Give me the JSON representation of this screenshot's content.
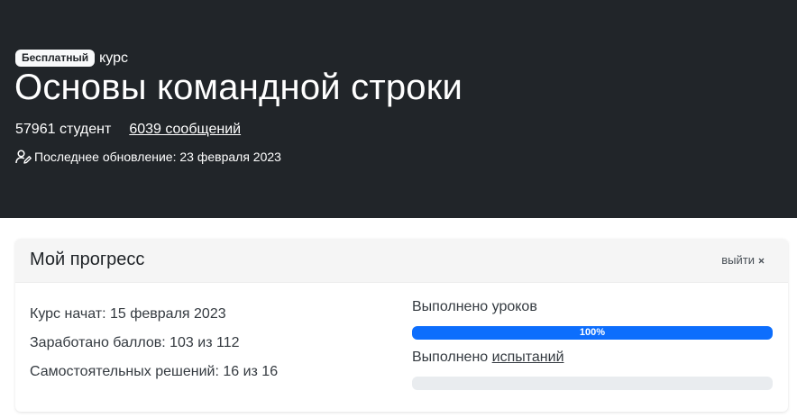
{
  "hero": {
    "badge": "Бесплатный",
    "course_word": "курс",
    "title": "Основы командной строки",
    "students": "57961 студент",
    "messages": "6039 сообщений",
    "last_update": "Последнее обновление: 23 февраля 2023"
  },
  "progress": {
    "title": "Мой прогресс",
    "exit_label": "выйти",
    "exit_icon": "close-icon",
    "course_started": "Курс начат: 15 февраля 2023",
    "points": "Заработано баллов: 103 из 112",
    "solutions": "Самостоятельных решений: 16 из 16",
    "lessons_label": "Выполнено уроков",
    "lessons_percent": 100,
    "lessons_percent_text": "100%",
    "challenges_prefix": "Выполнено ",
    "challenges_link": "испытаний",
    "challenges_percent": 0
  },
  "colors": {
    "hero_bg": "#212529",
    "accent": "#0d6efd"
  }
}
